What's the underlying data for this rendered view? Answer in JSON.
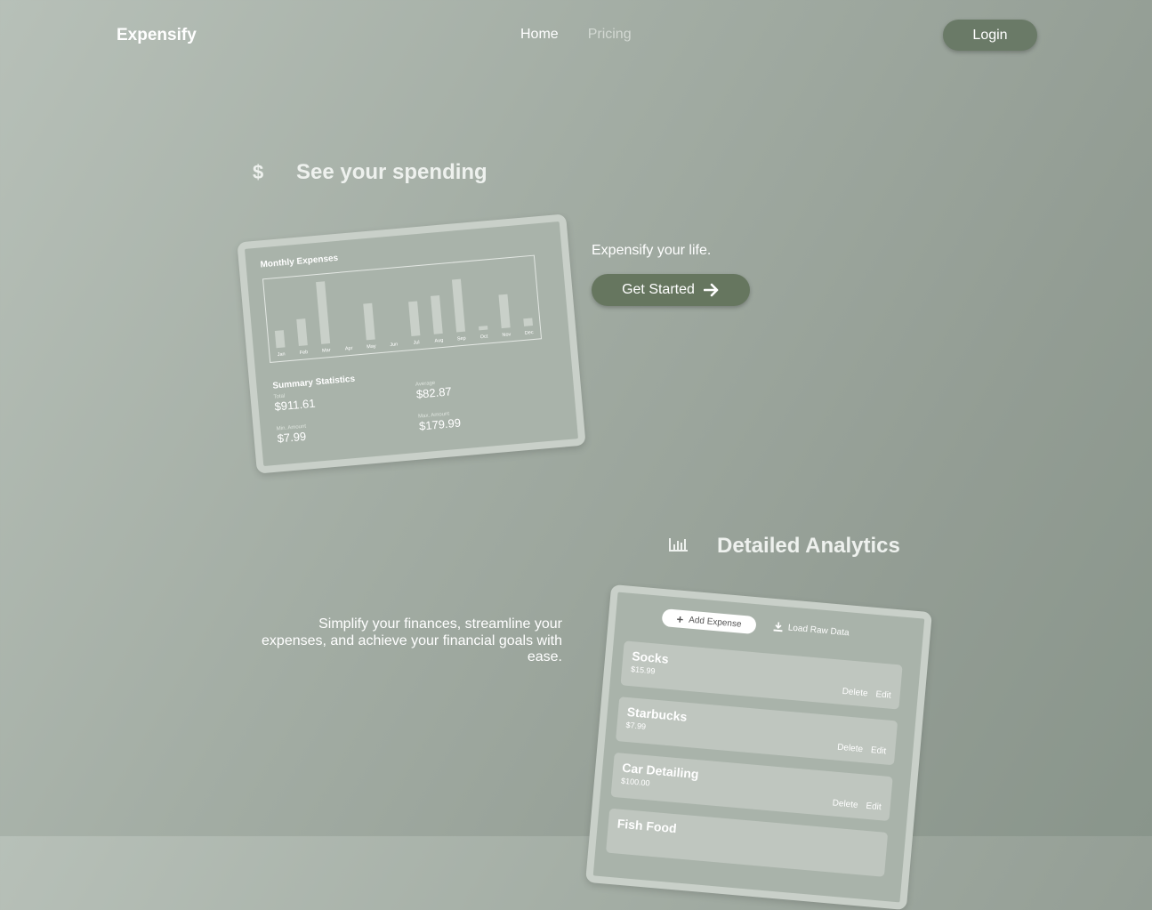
{
  "header": {
    "brand": "Expensify",
    "nav": [
      "Home",
      "Pricing"
    ],
    "login": "Login"
  },
  "section1": {
    "icon": "dollar-icon",
    "icon_glyph": "$",
    "title": "See your spending",
    "tagline": "Expensify your life.",
    "cta": "Get Started",
    "cta_icon": "arrow-right-icon"
  },
  "card1": {
    "title": "Monthly Expenses",
    "chart_data": {
      "type": "bar",
      "categories": [
        "Jan",
        "Feb",
        "Mar",
        "Apr",
        "May",
        "Jun",
        "Jul",
        "Aug",
        "Sep",
        "Oct",
        "Nov",
        "Dec"
      ],
      "values": [
        18,
        28,
        65,
        0,
        38,
        0,
        36,
        40,
        55,
        4,
        35,
        8
      ]
    },
    "summary_title": "Summary Statistics",
    "stats": [
      {
        "label": "Total",
        "value": "$911.61"
      },
      {
        "label": "Average",
        "value": "$82.87"
      },
      {
        "label": "Min. Amount",
        "value": "$7.99"
      },
      {
        "label": "Max. Amount",
        "value": "$179.99"
      }
    ]
  },
  "section2": {
    "icon": "bar-chart-icon",
    "title": "Detailed Analytics",
    "paragraph": "Simplify your finances, streamline your expenses, and achieve your financial goals with ease."
  },
  "card2": {
    "add_label": "Add Expense",
    "load_label": "Load Raw Data",
    "rows": [
      {
        "name": "Socks",
        "amount": "$15.99",
        "delete": "Delete",
        "edit": "Edit"
      },
      {
        "name": "Starbucks",
        "amount": "$7.99",
        "delete": "Delete",
        "edit": "Edit"
      },
      {
        "name": "Car Detailing",
        "amount": "$100.00",
        "delete": "Delete",
        "edit": "Edit"
      },
      {
        "name": "Fish Food",
        "amount": "",
        "delete": "",
        "edit": ""
      }
    ]
  },
  "colors": {
    "accent": "#6a7a67",
    "card_border": "#c9d0c9"
  }
}
